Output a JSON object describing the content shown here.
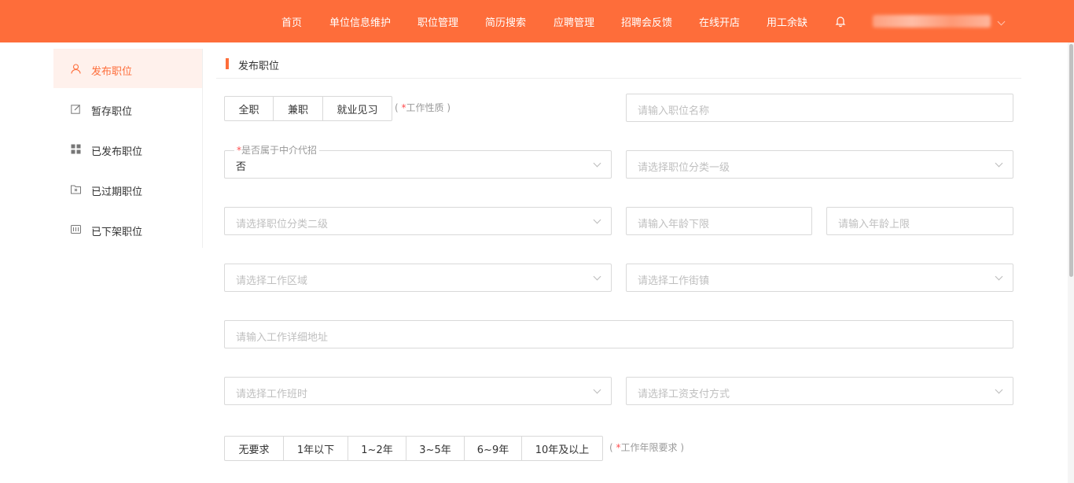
{
  "nav": {
    "items": [
      "首页",
      "单位信息维护",
      "职位管理",
      "简历搜索",
      "应聘管理",
      "招聘会反馈",
      "在线开店",
      "用工余缺"
    ]
  },
  "sidebar": {
    "items": [
      {
        "label": "发布职位",
        "icon": "user-icon",
        "active": true
      },
      {
        "label": "暂存职位",
        "icon": "edit-icon"
      },
      {
        "label": "已发布职位",
        "icon": "grid-icon"
      },
      {
        "label": "已过期职位",
        "icon": "expired-folder-icon"
      },
      {
        "label": "已下架职位",
        "icon": "offshelf-icon"
      }
    ]
  },
  "section": {
    "title": "发布职位"
  },
  "form": {
    "work_nature": {
      "options": [
        "全职",
        "兼职",
        "就业见习"
      ],
      "hint_prefix": "(",
      "hint_star": "*",
      "hint_text": "工作性质",
      "hint_suffix": ")"
    },
    "position_name": {
      "placeholder": "请输入职位名称"
    },
    "agency": {
      "label_star": "*",
      "label": "是否属于中介代招",
      "value": "否"
    },
    "category_level1": {
      "placeholder": "请选择职位分类一级"
    },
    "category_level2": {
      "placeholder": "请选择职位分类二级"
    },
    "age_min": {
      "placeholder": "请输入年龄下限"
    },
    "age_max": {
      "placeholder": "请输入年龄上限"
    },
    "work_area": {
      "placeholder": "请选择工作区域"
    },
    "work_street": {
      "placeholder": "请选择工作街镇"
    },
    "address": {
      "placeholder": "请输入工作详细地址"
    },
    "shift": {
      "placeholder": "请选择工作班时"
    },
    "pay_method": {
      "placeholder": "请选择工资支付方式"
    },
    "experience": {
      "options": [
        "无要求",
        "1年以下",
        "1~2年",
        "3~5年",
        "6~9年",
        "10年及以上"
      ],
      "hint_prefix": "(",
      "hint_star": "*",
      "hint_text": "工作年限要求",
      "hint_suffix": ")"
    }
  },
  "colors": {
    "brand": "#fe6d3a",
    "active_bg": "#fff1ec",
    "required": "#ff4d4f"
  }
}
